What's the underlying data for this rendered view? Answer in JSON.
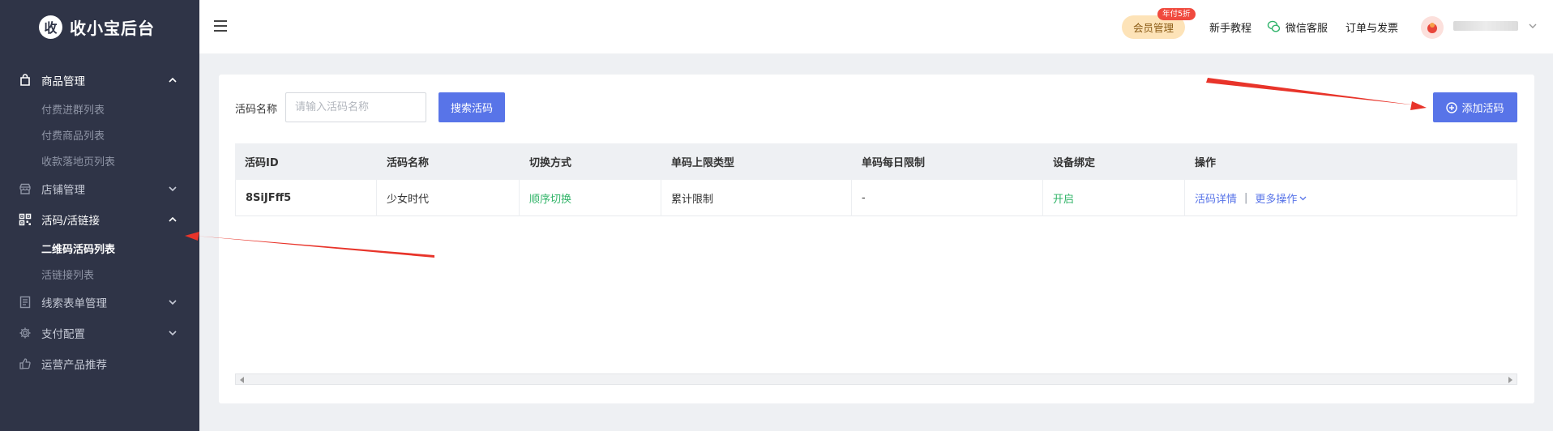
{
  "brand": {
    "logo_char": "收",
    "name": "收小宝后台"
  },
  "sidebar": {
    "groups": [
      {
        "label": "商品管理",
        "icon": "bag-icon",
        "open": true,
        "items": [
          {
            "label": "付费进群列表"
          },
          {
            "label": "付费商品列表"
          },
          {
            "label": "收款落地页列表"
          }
        ]
      },
      {
        "label": "店铺管理",
        "icon": "store-icon",
        "open": false
      },
      {
        "label": "活码/活链接",
        "icon": "qrcode-icon",
        "open": true,
        "items": [
          {
            "label": "二维码活码列表",
            "active": true
          },
          {
            "label": "活链接列表"
          }
        ]
      },
      {
        "label": "线索表单管理",
        "icon": "form-icon",
        "open": false
      },
      {
        "label": "支付配置",
        "icon": "gear-icon",
        "open": false
      },
      {
        "label": "运营产品推荐",
        "icon": "thumbs-up-icon",
        "open": false
      }
    ]
  },
  "header": {
    "vip_label": "会员管理",
    "vip_badge": "年付5折",
    "links": {
      "tutorial": "新手教程",
      "wechat_service": "微信客服",
      "orders_invoice": "订单与发票"
    }
  },
  "search": {
    "label": "活码名称",
    "placeholder": "请输入活码名称",
    "value": "",
    "button": "搜索活码"
  },
  "add_button": "添加活码",
  "table": {
    "columns": [
      "活码ID",
      "活码名称",
      "切换方式",
      "单码上限类型",
      "单码每日限制",
      "设备绑定",
      "操作"
    ],
    "rows": [
      {
        "id": "8SiJFff5",
        "name": "少女时代",
        "switch_mode": "顺序切换",
        "limit_type": "累计限制",
        "daily_limit": "-",
        "device_binding": "开启",
        "action_detail": "活码详情",
        "action_more": "更多操作"
      }
    ]
  },
  "colors": {
    "sidebar_bg": "#2f3447",
    "primary": "#5874e8",
    "success": "#31b468",
    "annotation_arrow": "#e8342a"
  }
}
